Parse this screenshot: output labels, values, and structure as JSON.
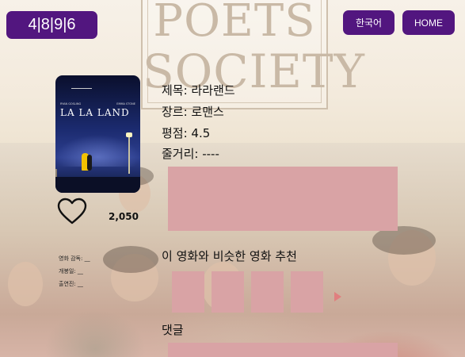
{
  "header": {
    "logo": "4|8|9|6",
    "language_button": "한국어",
    "home_button": "HOME"
  },
  "background_sign": {
    "line1": "POETS",
    "line2": "SOCIETY"
  },
  "poster": {
    "title": "LA LA LAND",
    "actor_left": "RYAN GOSLING",
    "actor_right": "EMMA STONE"
  },
  "like": {
    "count": "2,050"
  },
  "credits": {
    "director": "영화 감독: __",
    "release": "개봉일: __",
    "cast": "출연진: __"
  },
  "movie": {
    "title": "제목: 라라랜드",
    "genre": "장르: 로맨스",
    "rating": "평점: 4.5",
    "plot": "줄거리: ----"
  },
  "recommend": {
    "title": "이 영화와 비슷한 영화 추천"
  },
  "comments": {
    "title": "댓글"
  },
  "colors": {
    "brand": "#52167f",
    "placeholder": "#d9a3a5"
  }
}
